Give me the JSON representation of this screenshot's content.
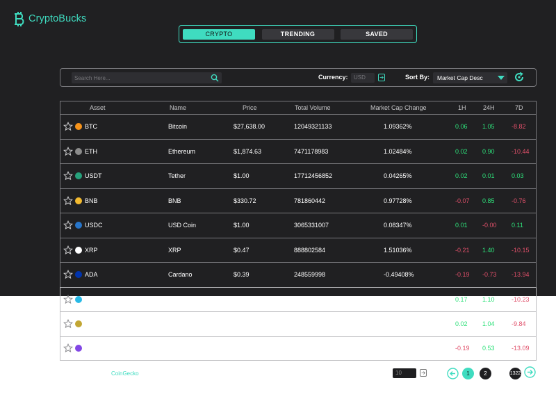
{
  "app": {
    "title": "CryptoBucks"
  },
  "tabs": [
    {
      "label": "CRYPTO",
      "active": true
    },
    {
      "label": "TRENDING",
      "active": false
    },
    {
      "label": "SAVED",
      "active": false
    }
  ],
  "controls": {
    "search_placeholder": "Search Here...",
    "currency_label": "Currency:",
    "currency_value": "USD",
    "sortby_label": "Sort By:",
    "sort_value": "Market Cap Desc"
  },
  "table": {
    "headers": [
      "Asset",
      "Name",
      "Price",
      "Total Volume",
      "Market Cap Change",
      "1H",
      "24H",
      "7D"
    ],
    "rows": [
      {
        "symbol": "BTC",
        "name": "Bitcoin",
        "price": "$27,638.00",
        "volume": "12049321133",
        "mcap_change": "1.09362%",
        "h1": "0.06",
        "h24": "1.05",
        "d7": "-8.82",
        "icon_color": "#f7931a"
      },
      {
        "symbol": "ETH",
        "name": "Ethereum",
        "price": "$1,874.63",
        "volume": "7471178983",
        "mcap_change": "1.02484%",
        "h1": "0.02",
        "h24": "0.90",
        "d7": "-10.44",
        "icon_color": "#8c8c8c"
      },
      {
        "symbol": "USDT",
        "name": "Tether",
        "price": "$1.00",
        "volume": "17712456852",
        "mcap_change": "0.04265%",
        "h1": "0.02",
        "h24": "0.01",
        "d7": "0.03",
        "icon_color": "#26a17b"
      },
      {
        "symbol": "BNB",
        "name": "BNB",
        "price": "$330.72",
        "volume": "781860442",
        "mcap_change": "0.97728%",
        "h1": "-0.07",
        "h24": "0.85",
        "d7": "-0.76",
        "icon_color": "#f3ba2f"
      },
      {
        "symbol": "USDC",
        "name": "USD Coin",
        "price": "$1.00",
        "volume": "3065331007",
        "mcap_change": "0.08347%",
        "h1": "0.01",
        "h24": "-0.00",
        "d7": "0.11",
        "icon_color": "#2775ca"
      },
      {
        "symbol": "XRP",
        "name": "XRP",
        "price": "$0.47",
        "volume": "888802584",
        "mcap_change": "1.51036%",
        "h1": "-0.21",
        "h24": "1.40",
        "d7": "-10.15",
        "icon_color": "#ffffff"
      },
      {
        "symbol": "ADA",
        "name": "Cardano",
        "price": "$0.39",
        "volume": "248559998",
        "mcap_change": "-0.49408%",
        "h1": "-0.19",
        "h24": "-0.73",
        "d7": "-13.94",
        "icon_color": "#0033ad"
      },
      {
        "symbol": "",
        "name": "",
        "price": "",
        "volume": "",
        "mcap_change": "",
        "h1": "0.17",
        "h24": "1.10",
        "d7": "-10.23",
        "icon_color": "#27b9e6"
      },
      {
        "symbol": "",
        "name": "",
        "price": "",
        "volume": "",
        "mcap_change": "",
        "h1": "0.02",
        "h24": "1.04",
        "d7": "-9.84",
        "icon_color": "#c2a633"
      },
      {
        "symbol": "",
        "name": "",
        "price": "",
        "volume": "",
        "mcap_change": "",
        "h1": "-0.19",
        "h24": "0.53",
        "d7": "-13.09",
        "icon_color": "#8247e5"
      }
    ]
  },
  "footer": {
    "source": "CoinGecko",
    "per_page": "10",
    "pages": [
      "1",
      "2",
      "1322"
    ],
    "current_page": "1"
  },
  "colors": {
    "accent": "#3fdcc0",
    "positive": "#2ee07a",
    "negative": "#e0506a",
    "background": "#202022"
  }
}
